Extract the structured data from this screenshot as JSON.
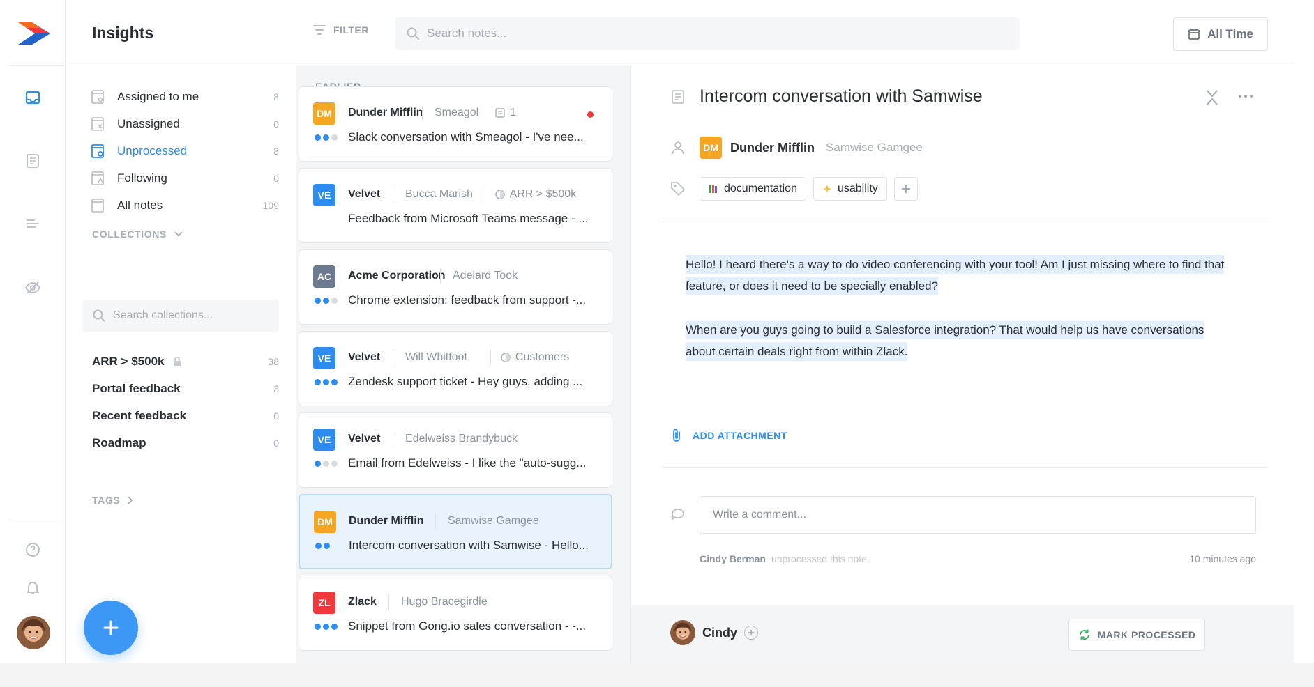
{
  "header": {
    "title": "Insights",
    "filter_label": "FILTER",
    "search_placeholder": "Search notes...",
    "time_range": "All Time"
  },
  "sidebar": {
    "nav": [
      {
        "label": "Assigned to me",
        "count": "8",
        "icon": "inbox-assigned-icon"
      },
      {
        "label": "Unassigned",
        "count": "0",
        "icon": "inbox-unassigned-icon"
      },
      {
        "label": "Unprocessed",
        "count": "8",
        "icon": "inbox-unprocessed-icon",
        "active": true
      },
      {
        "label": "Following",
        "count": "0",
        "icon": "inbox-following-icon"
      },
      {
        "label": "All notes",
        "count": "109",
        "icon": "inbox-all-icon"
      }
    ],
    "collections_label": "COLLECTIONS",
    "collections_search_placeholder": "Search collections...",
    "collections": [
      {
        "label": "ARR > $500k",
        "count": "38",
        "locked": true
      },
      {
        "label": "Portal feedback",
        "count": "3"
      },
      {
        "label": "Recent feedback",
        "count": "0"
      },
      {
        "label": "Roadmap",
        "count": "0"
      }
    ],
    "tags_label": "TAGS",
    "fab_label": "+"
  },
  "list": {
    "heading": "EARLIER",
    "notes": [
      {
        "badge": "DM",
        "badge_color": "#f5a623",
        "company": "Dunder Mifflin",
        "contact": "Smeagol",
        "extra": "1",
        "extra_icon": "note-count-icon",
        "unread": true,
        "dots": [
          "#2d8cf0",
          "#2d8cf0",
          "#d8dce1"
        ],
        "text": "Slack conversation with Smeagol - I've nee..."
      },
      {
        "badge": "VE",
        "badge_color": "#2d8cf0",
        "company": "Velvet",
        "contact": "Bucca Marish",
        "extra": "ARR > $500k",
        "extra_icon": "collection-icon",
        "dots": [],
        "text": "Feedback from Microsoft Teams message - ..."
      },
      {
        "badge": "AC",
        "badge_color": "#6b7a8f",
        "company": "Acme Corporation",
        "contact": "Adelard Took",
        "extra": "",
        "dots": [
          "#2d8cf0",
          "#2d8cf0",
          "#d8dce1"
        ],
        "text": "Chrome extension: feedback from support -..."
      },
      {
        "badge": "VE",
        "badge_color": "#2d8cf0",
        "company": "Velvet",
        "contact": "Will Whitfoot",
        "extra": "Customers",
        "extra_icon": "collection-icon",
        "dots": [
          "#2d8cf0",
          "#2d8cf0",
          "#2d8cf0"
        ],
        "text": "Zendesk support ticket - Hey guys, adding ..."
      },
      {
        "badge": "VE",
        "badge_color": "#2d8cf0",
        "company": "Velvet",
        "contact": "Edelweiss Brandybuck",
        "extra": "",
        "dots": [
          "#2d8cf0",
          "#d8dce1",
          "#d8dce1"
        ],
        "text": "Email from Edelweiss - I like the \"auto-sugg..."
      },
      {
        "badge": "DM",
        "badge_color": "#f5a623",
        "company": "Dunder Mifflin",
        "contact": "Samwise Gamgee",
        "extra": "",
        "selected": true,
        "dots": [
          "#2d8cf0",
          "#2d8cf0"
        ],
        "text": "Intercom conversation with Samwise - Hello..."
      },
      {
        "badge": "ZL",
        "badge_color": "#f0393a",
        "company": "Zlack",
        "contact": "Hugo Bracegirdle",
        "extra": "",
        "dots": [
          "#2d8cf0",
          "#2d8cf0",
          "#2d8cf0"
        ],
        "text": "Snippet from Gong.io sales conversation - -..."
      }
    ]
  },
  "detail": {
    "title": "Intercom conversation with Samwise",
    "badge": "DM",
    "badge_color": "#f5a623",
    "company": "Dunder Mifflin",
    "contact": "Samwise Gamgee",
    "tags": [
      {
        "label": "documentation",
        "icon": "books-icon"
      },
      {
        "label": "usability",
        "icon": "sparkles-icon"
      }
    ],
    "paragraphs": [
      "Hello! I heard there's a way to do video conferencing with your tool! Am I just missing where to find that feature, or does it need to be specially enabled?",
      "When are you guys going to build a Salesforce integration? That would help us have conversations about certain deals right from within Zlack."
    ],
    "attach_label": "ADD ATTACHMENT",
    "comment_placeholder": "Write a comment...",
    "activity_user": "Cindy Berman",
    "activity_action": "unprocessed this note.",
    "activity_time": "10 minutes ago",
    "footer_user": "Cindy",
    "mark_label": "MARK PROCESSED"
  },
  "colors": {
    "accent": "#2d8cf0",
    "fab": "#3d98f5",
    "highlight": "#e3effc"
  }
}
